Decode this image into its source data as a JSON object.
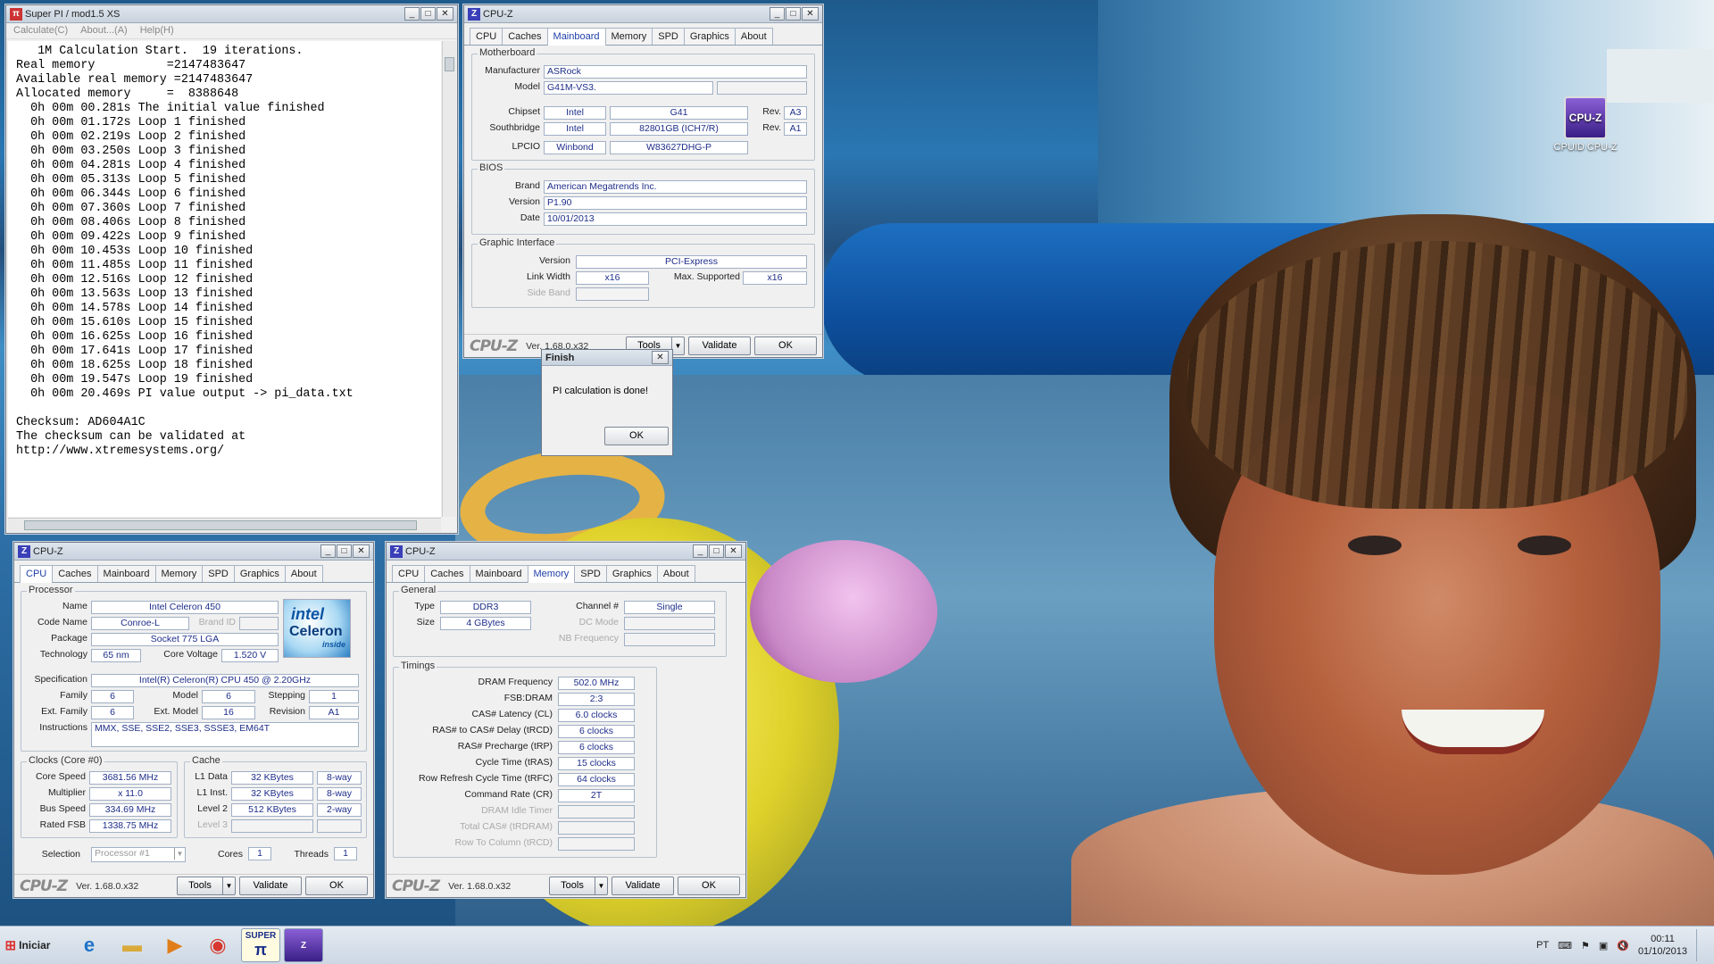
{
  "superpi": {
    "title": "Super PI / mod1.5 XS",
    "menu": [
      "Calculate(C)",
      "About...(A)",
      "Help(H)"
    ],
    "output": "   1M Calculation Start.  19 iterations.\nReal memory          =2147483647\nAvailable real memory =2147483647\nAllocated memory     =  8388648\n  0h 00m 00.281s The initial value finished\n  0h 00m 01.172s Loop 1 finished\n  0h 00m 02.219s Loop 2 finished\n  0h 00m 03.250s Loop 3 finished\n  0h 00m 04.281s Loop 4 finished\n  0h 00m 05.313s Loop 5 finished\n  0h 00m 06.344s Loop 6 finished\n  0h 00m 07.360s Loop 7 finished\n  0h 00m 08.406s Loop 8 finished\n  0h 00m 09.422s Loop 9 finished\n  0h 00m 10.453s Loop 10 finished\n  0h 00m 11.485s Loop 11 finished\n  0h 00m 12.516s Loop 12 finished\n  0h 00m 13.563s Loop 13 finished\n  0h 00m 14.578s Loop 14 finished\n  0h 00m 15.610s Loop 15 finished\n  0h 00m 16.625s Loop 16 finished\n  0h 00m 17.641s Loop 17 finished\n  0h 00m 18.625s Loop 18 finished\n  0h 00m 19.547s Loop 19 finished\n  0h 00m 20.469s PI value output -> pi_data.txt\n\nChecksum: AD604A1C\nThe checksum can be validated at\nhttp://www.xtremesystems.org/"
  },
  "tabs": [
    "CPU",
    "Caches",
    "Mainboard",
    "Memory",
    "SPD",
    "Graphics",
    "About"
  ],
  "common": {
    "cpuz_title": "CPU-Z",
    "logo": "CPU-Z",
    "version": "Ver. 1.68.0.x32",
    "tools": "Tools",
    "validate": "Validate",
    "ok": "OK"
  },
  "mainboard": {
    "section_motherboard": "Motherboard",
    "manufacturer_label": "Manufacturer",
    "manufacturer": "ASRock",
    "model_label": "Model",
    "model": "G41M-VS3.",
    "chipset_label": "Chipset",
    "chipset_vendor": "Intel",
    "chipset": "G41",
    "chipset_rev_label": "Rev.",
    "chipset_rev": "A3",
    "southbridge_label": "Southbridge",
    "southbridge_vendor": "Intel",
    "southbridge": "82801GB (ICH7/R)",
    "southbridge_rev_label": "Rev.",
    "southbridge_rev": "A1",
    "lpcio_label": "LPCIO",
    "lpcio_vendor": "Winbond",
    "lpcio": "W83627DHG-P",
    "section_bios": "BIOS",
    "brand_label": "Brand",
    "brand": "American Megatrends Inc.",
    "version_label": "Version",
    "bios_version": "P1.90",
    "date_label": "Date",
    "bios_date": "10/01/2013",
    "section_graphic": "Graphic Interface",
    "gi_version_label": "Version",
    "gi_version": "PCI-Express",
    "link_width_label": "Link Width",
    "link_width": "x16",
    "max_supported_label": "Max. Supported",
    "max_supported": "x16",
    "side_band_label": "Side Band"
  },
  "dialog": {
    "title": "Finish",
    "message": "PI calculation is done!",
    "ok": "OK"
  },
  "cpu": {
    "section_processor": "Processor",
    "name_label": "Name",
    "name": "Intel Celeron 450",
    "codename_label": "Code Name",
    "codename": "Conroe-L",
    "brandid_label": "Brand ID",
    "package_label": "Package",
    "package": "Socket 775 LGA",
    "technology_label": "Technology",
    "technology": "65 nm",
    "core_voltage_label": "Core Voltage",
    "core_voltage": "1.520 V",
    "spec_label": "Specification",
    "spec": "Intel(R) Celeron(R) CPU       450  @ 2.20GHz",
    "family_label": "Family",
    "family": "6",
    "model_label": "Model",
    "model": "6",
    "stepping_label": "Stepping",
    "stepping": "1",
    "extfamily_label": "Ext. Family",
    "extfamily": "6",
    "extmodel_label": "Ext. Model",
    "extmodel": "16",
    "revision_label": "Revision",
    "revision": "A1",
    "instructions_label": "Instructions",
    "instructions": "MMX, SSE, SSE2, SSE3, SSSE3, EM64T",
    "section_clocks": "Clocks (Core #0)",
    "core_speed_label": "Core Speed",
    "core_speed": "3681.56 MHz",
    "multiplier_label": "Multiplier",
    "multiplier": "x 11.0",
    "bus_speed_label": "Bus Speed",
    "bus_speed": "334.69 MHz",
    "rated_fsb_label": "Rated FSB",
    "rated_fsb": "1338.75 MHz",
    "section_cache": "Cache",
    "l1d_label": "L1 Data",
    "l1d": "32 KBytes",
    "l1d_way": "8-way",
    "l1i_label": "L1 Inst.",
    "l1i": "32 KBytes",
    "l1i_way": "8-way",
    "l2_label": "Level 2",
    "l2": "512 KBytes",
    "l2_way": "2-way",
    "l3_label": "Level 3",
    "selection_label": "Selection",
    "selection": "Processor #1",
    "cores_label": "Cores",
    "cores": "1",
    "threads_label": "Threads",
    "threads": "1",
    "logo_top": "intel",
    "logo_mid": "Celeron",
    "logo_bot": "inside"
  },
  "memory": {
    "section_general": "General",
    "type_label": "Type",
    "type": "DDR3",
    "channel_label": "Channel #",
    "channel": "Single",
    "size_label": "Size",
    "size": "4 GBytes",
    "dc_mode_label": "DC Mode",
    "nb_freq_label": "NB Frequency",
    "section_timings": "Timings",
    "dram_freq_label": "DRAM Frequency",
    "dram_freq": "502.0 MHz",
    "fsb_dram_label": "FSB:DRAM",
    "fsb_dram": "2:3",
    "cl_label": "CAS# Latency (CL)",
    "cl": "6.0 clocks",
    "trcd_label": "RAS# to CAS# Delay (tRCD)",
    "trcd": "6 clocks",
    "trp_label": "RAS# Precharge (tRP)",
    "trp": "6 clocks",
    "tras_label": "Cycle Time (tRAS)",
    "tras": "15 clocks",
    "trfc_label": "Row Refresh Cycle Time (tRFC)",
    "trfc": "64 clocks",
    "cr_label": "Command Rate (CR)",
    "cr": "2T",
    "idle_label": "DRAM Idle Timer",
    "trdram_label": "Total CAS# (tRDRAM)",
    "trcd2_label": "Row To Column (tRCD)"
  },
  "desktop": {
    "cpuz_icon_label": "CPUID CPU-Z",
    "cpuz_icon_text": "CPU-Z"
  },
  "taskbar": {
    "start": "Iniciar",
    "lang": "PT",
    "time": "00:11",
    "date": "01/10/2013",
    "superpi_text": "SUPER"
  }
}
